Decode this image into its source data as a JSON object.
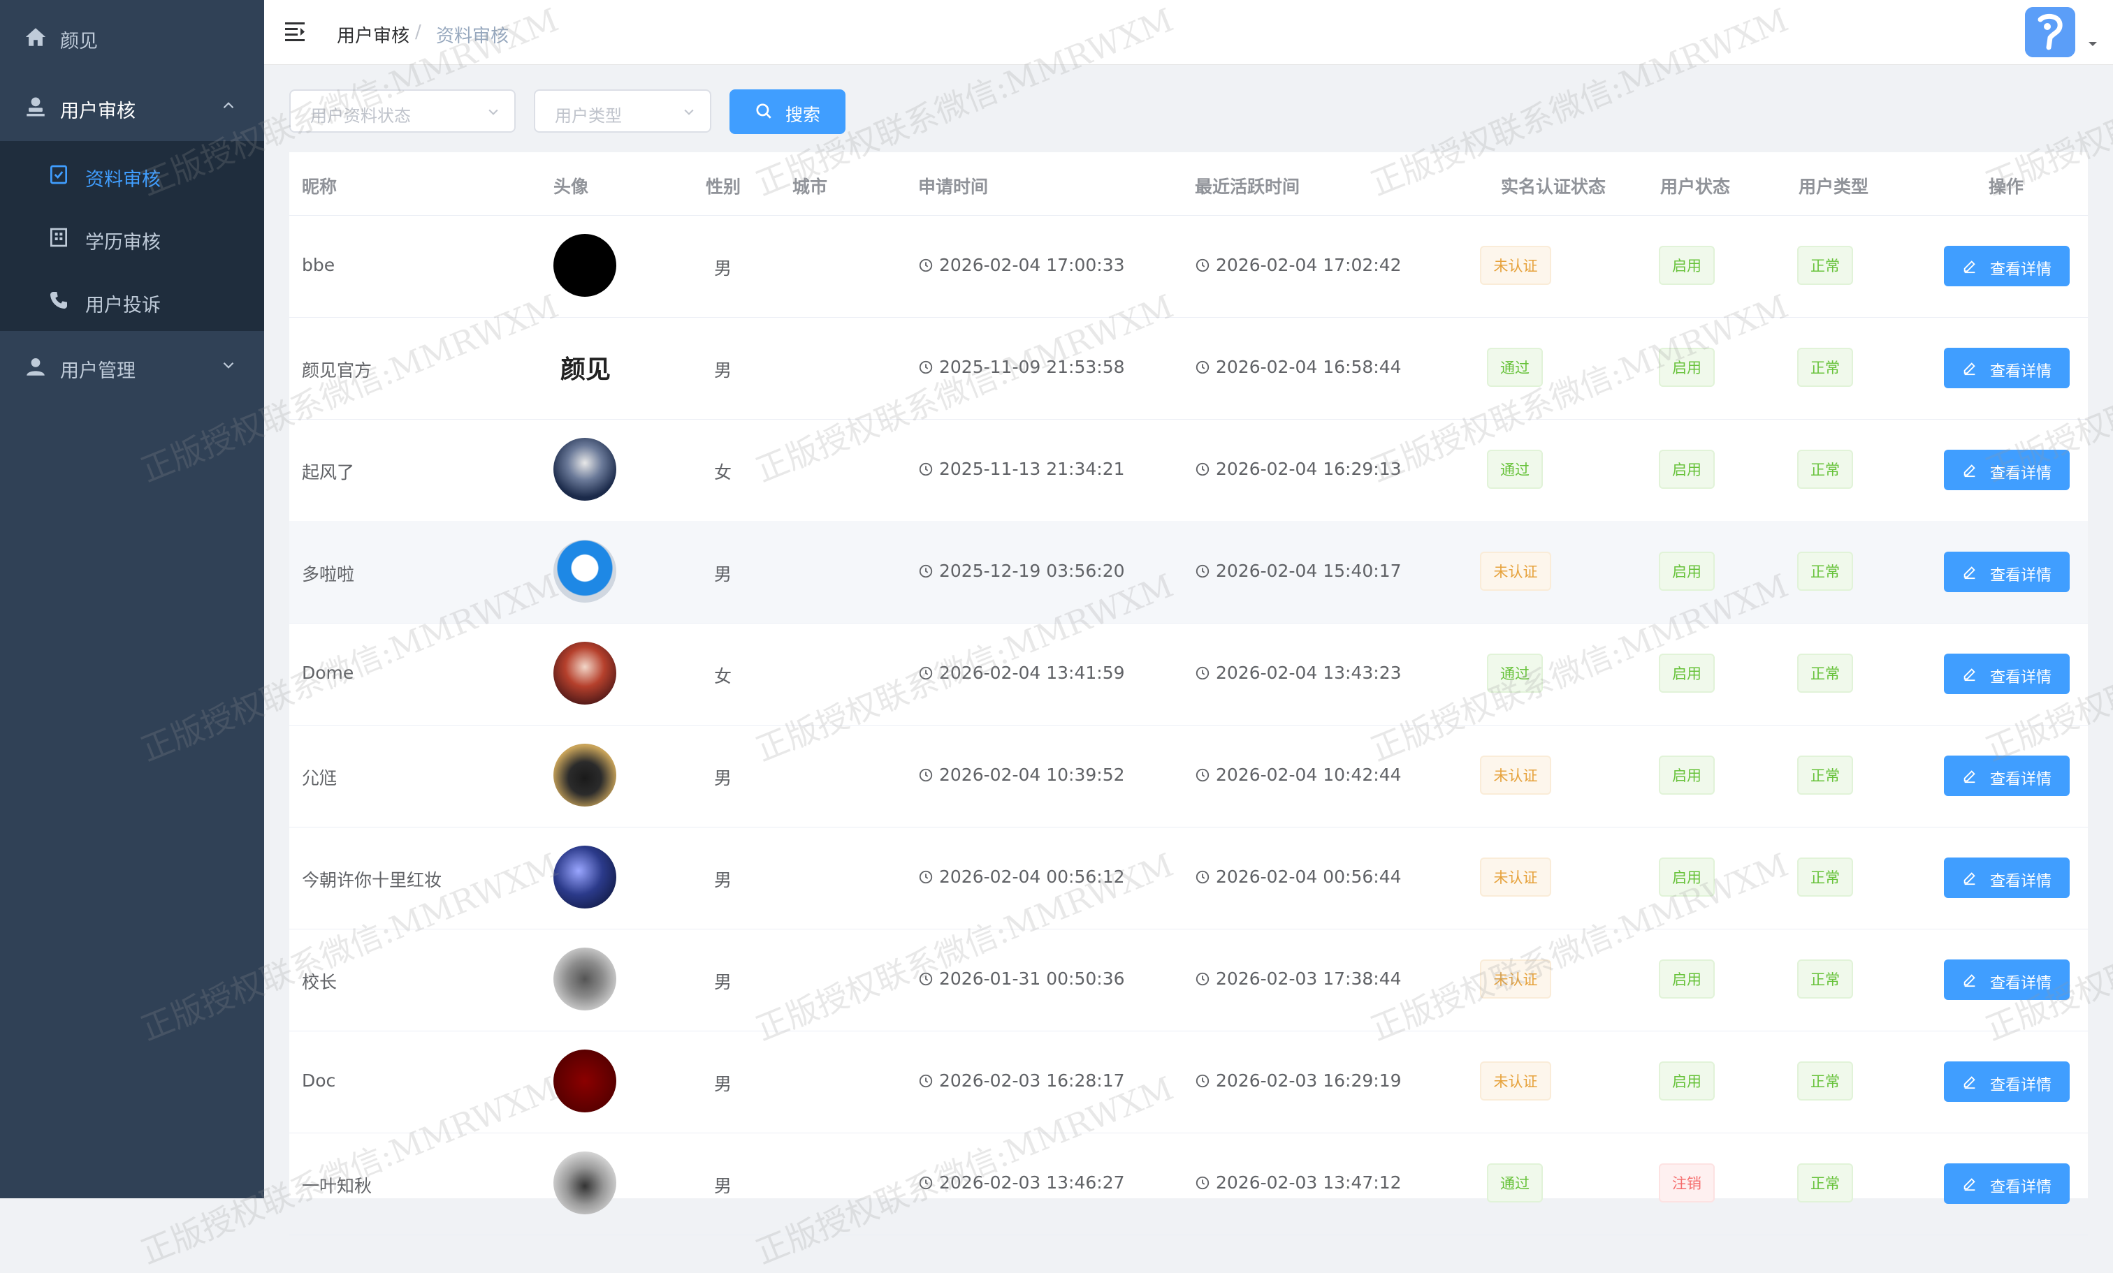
{
  "sidebar": {
    "home_label": "颜见",
    "audit_label": "用户审核",
    "sub_profile": "资料审核",
    "sub_education": "学历审核",
    "sub_complaint": "用户投诉",
    "manage_label": "用户管理"
  },
  "navbar": {
    "crumb_1": "用户审核",
    "crumb_sep": "/",
    "crumb_2": "资料审核"
  },
  "filters": {
    "status_placeholder": "用户资料状态",
    "type_placeholder": "用户类型",
    "search_label": "搜索"
  },
  "table": {
    "headers": [
      "昵称",
      "头像",
      "性别",
      "城市",
      "申请时间",
      "最近活跃时间",
      "实名认证状态",
      "用户状态",
      "用户类型",
      "操作"
    ],
    "detail_label": "查看详情",
    "rows": [
      {
        "nick": "bbe",
        "avatar": "",
        "gender": "男",
        "city": "",
        "apply": "2026-02-04 17:00:33",
        "active": "2026-02-04 17:02:42",
        "auth": "未认证",
        "status": "启用",
        "type": "正常"
      },
      {
        "nick": "颜见官方",
        "avatar": "颜见",
        "gender": "男",
        "city": "",
        "apply": "2025-11-09 21:53:58",
        "active": "2026-02-04 16:58:44",
        "auth": "通过",
        "status": "启用",
        "type": "正常"
      },
      {
        "nick": "起风了",
        "avatar": "",
        "gender": "女",
        "city": "",
        "apply": "2025-11-13 21:34:21",
        "active": "2026-02-04 16:29:13",
        "auth": "通过",
        "status": "启用",
        "type": "正常"
      },
      {
        "nick": "多啦啦",
        "avatar": "",
        "gender": "男",
        "city": "",
        "apply": "2025-12-19 03:56:20",
        "active": "2026-02-04 15:40:17",
        "auth": "未认证",
        "status": "启用",
        "type": "正常"
      },
      {
        "nick": "Dome",
        "avatar": "",
        "gender": "女",
        "city": "",
        "apply": "2026-02-04 13:41:59",
        "active": "2026-02-04 13:43:23",
        "auth": "通过",
        "status": "启用",
        "type": "正常"
      },
      {
        "nick": "尣尩",
        "avatar": "",
        "gender": "男",
        "city": "",
        "apply": "2026-02-04 10:39:52",
        "active": "2026-02-04 10:42:44",
        "auth": "未认证",
        "status": "启用",
        "type": "正常"
      },
      {
        "nick": "今朝许你十里红妆",
        "avatar": "",
        "gender": "男",
        "city": "",
        "apply": "2026-02-04 00:56:12",
        "active": "2026-02-04 00:56:44",
        "auth": "未认证",
        "status": "启用",
        "type": "正常"
      },
      {
        "nick": "校长",
        "avatar": "",
        "gender": "男",
        "city": "",
        "apply": "2026-01-31 00:50:36",
        "active": "2026-02-03 17:38:44",
        "auth": "未认证",
        "status": "启用",
        "type": "正常"
      },
      {
        "nick": "Doc",
        "avatar": "",
        "gender": "男",
        "city": "",
        "apply": "2026-02-03 16:28:17",
        "active": "2026-02-03 16:29:19",
        "auth": "未认证",
        "status": "启用",
        "type": "正常"
      },
      {
        "nick": "一叶知秋",
        "avatar": "",
        "gender": "男",
        "city": "",
        "apply": "2026-02-03 13:46:27",
        "active": "2026-02-03 13:47:12",
        "auth": "通过",
        "status": "注销",
        "type": "正常"
      }
    ]
  },
  "watermark": "正版授权联系微信:MMRWXM",
  "colors": {
    "sidebar_bg": "#304156",
    "primary": "#409eff",
    "warning": "#e6a23c",
    "success": "#67c23a",
    "danger": "#f56c6c"
  }
}
